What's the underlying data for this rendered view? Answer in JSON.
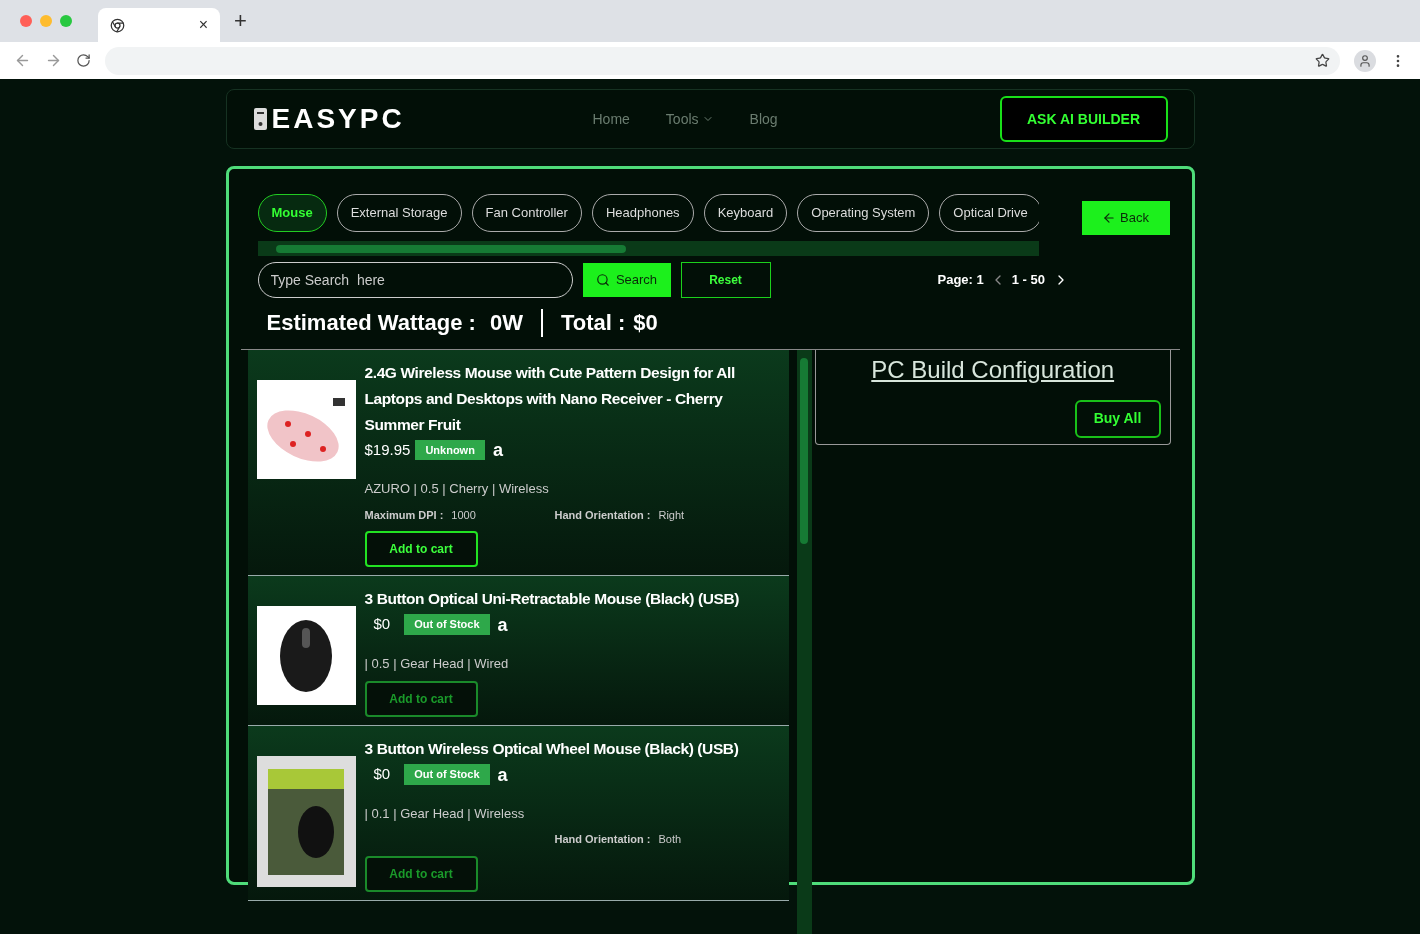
{
  "browser": {
    "tab_close": "×",
    "new_tab": "+"
  },
  "nav": {
    "logo": "EASYPC",
    "links": [
      {
        "label": "Home",
        "dropdown": false
      },
      {
        "label": "Tools",
        "dropdown": true
      },
      {
        "label": "Blog",
        "dropdown": false
      }
    ],
    "cta": "ASK AI BUILDER"
  },
  "categories": [
    {
      "label": "Mouse",
      "selected": true
    },
    {
      "label": "External Storage",
      "selected": false
    },
    {
      "label": "Fan Controller",
      "selected": false
    },
    {
      "label": "Headphones",
      "selected": false
    },
    {
      "label": "Keyboard",
      "selected": false
    },
    {
      "label": "Operating System",
      "selected": false
    },
    {
      "label": "Optical Drive",
      "selected": false
    }
  ],
  "back_button": "Back",
  "search": {
    "placeholder": "Type Search  here",
    "button": "Search",
    "reset": "Reset"
  },
  "pagination": {
    "page": "Page: 1",
    "range": "1 - 50"
  },
  "summary": {
    "wattage_label": "Estimated Wattage :",
    "wattage": "0W",
    "total_label": "Total :",
    "total": "$0"
  },
  "products": [
    {
      "title": "2.4G Wireless Mouse with Cute Pattern Design for All Laptops and Desktops with Nano Receiver - Cherry Summer Fruit",
      "price": "$19.95",
      "stock": "Unknown",
      "amazon_logo": "a",
      "kind": "pink",
      "specs": "AZURO | 0.5 | Cherry | Wireless",
      "max_dpi": {
        "label": "Maximum DPI :",
        "value": "1000"
      },
      "hand_orientation": {
        "label": "Hand Orientation :",
        "value": "Right"
      },
      "cart": "Add to cart",
      "disabled": false
    },
    {
      "title": "3 Button Optical Uni-Retractable Mouse (Black) (USB)",
      "price": "$0",
      "stock": "Out of Stock",
      "amazon_logo": "a",
      "kind": "black",
      "specs": "| 0.5 | Gear Head | Wired",
      "cart": "Add to cart",
      "disabled": true
    },
    {
      "title": "3 Button Wireless Optical Wheel Mouse (Black) (USB)",
      "price": "$0",
      "stock": "Out of Stock",
      "amazon_logo": "a",
      "kind": "box",
      "specs": "| 0.1 | Gear Head | Wireless",
      "hand_orientation": {
        "label": "Hand Orientation :",
        "value": "Both"
      },
      "cart": "Add to cart",
      "disabled": true
    }
  ],
  "build": {
    "title": "PC Build Configuration",
    "buy_all": "Buy All"
  }
}
